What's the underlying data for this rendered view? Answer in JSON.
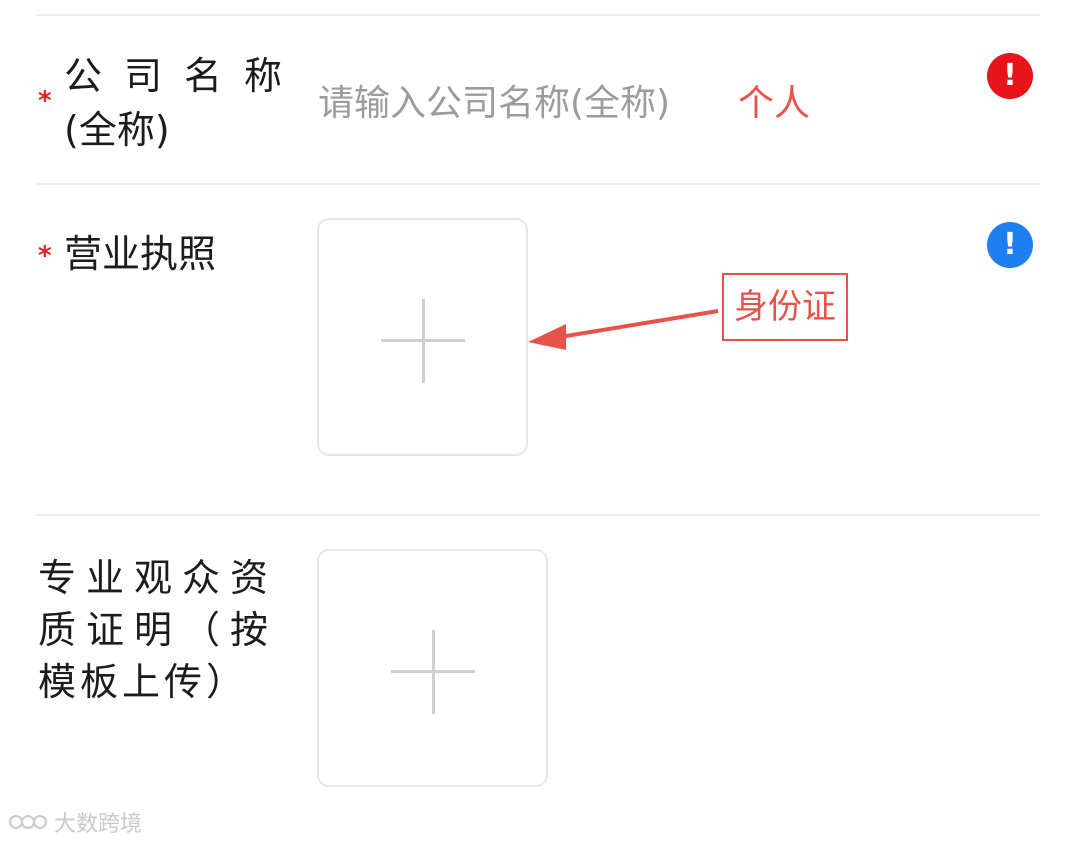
{
  "form": {
    "company_name": {
      "required_mark": "*",
      "label_line1": "公司名称",
      "label_line2": "(全称)",
      "placeholder": "请输入公司名称(全称)",
      "annotation": "个人",
      "status_icon": "exclamation-icon",
      "status_color": "#e8141c"
    },
    "business_license": {
      "required_mark": "*",
      "label": "营业执照",
      "status_icon": "exclamation-icon",
      "status_color": "#1e7ff0",
      "callout": "身份证",
      "callout_color": "#e5534b"
    },
    "qualification": {
      "label_line1": "专业观众资",
      "label_line2": "质证明（按",
      "label_line3": "模板上传）"
    },
    "upload_icon": "plus-icon"
  },
  "watermark": {
    "icon": "logo-icon",
    "text": "大数跨境"
  }
}
